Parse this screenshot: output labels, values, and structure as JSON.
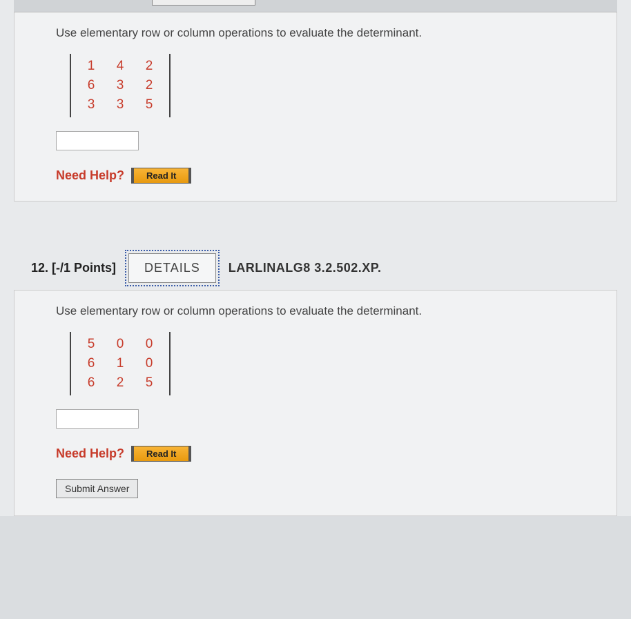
{
  "q1": {
    "prompt": "Use elementary row or column operations to evaluate the determinant.",
    "matrix": [
      [
        "1",
        "4",
        "2"
      ],
      [
        "6",
        "3",
        "2"
      ],
      [
        "3",
        "3",
        "5"
      ]
    ],
    "need_help_label": "Need Help?",
    "read_it_label": "Read It"
  },
  "q2": {
    "number": "12.",
    "points": "[-/1 Points]",
    "details_label": "DETAILS",
    "code": "LARLINALG8 3.2.502.XP.",
    "prompt": "Use elementary row or column operations to evaluate the determinant.",
    "matrix": [
      [
        "5",
        "0",
        "0"
      ],
      [
        "6",
        "1",
        "0"
      ],
      [
        "6",
        "2",
        "5"
      ]
    ],
    "need_help_label": "Need Help?",
    "read_it_label": "Read It",
    "submit_label": "Submit Answer"
  }
}
